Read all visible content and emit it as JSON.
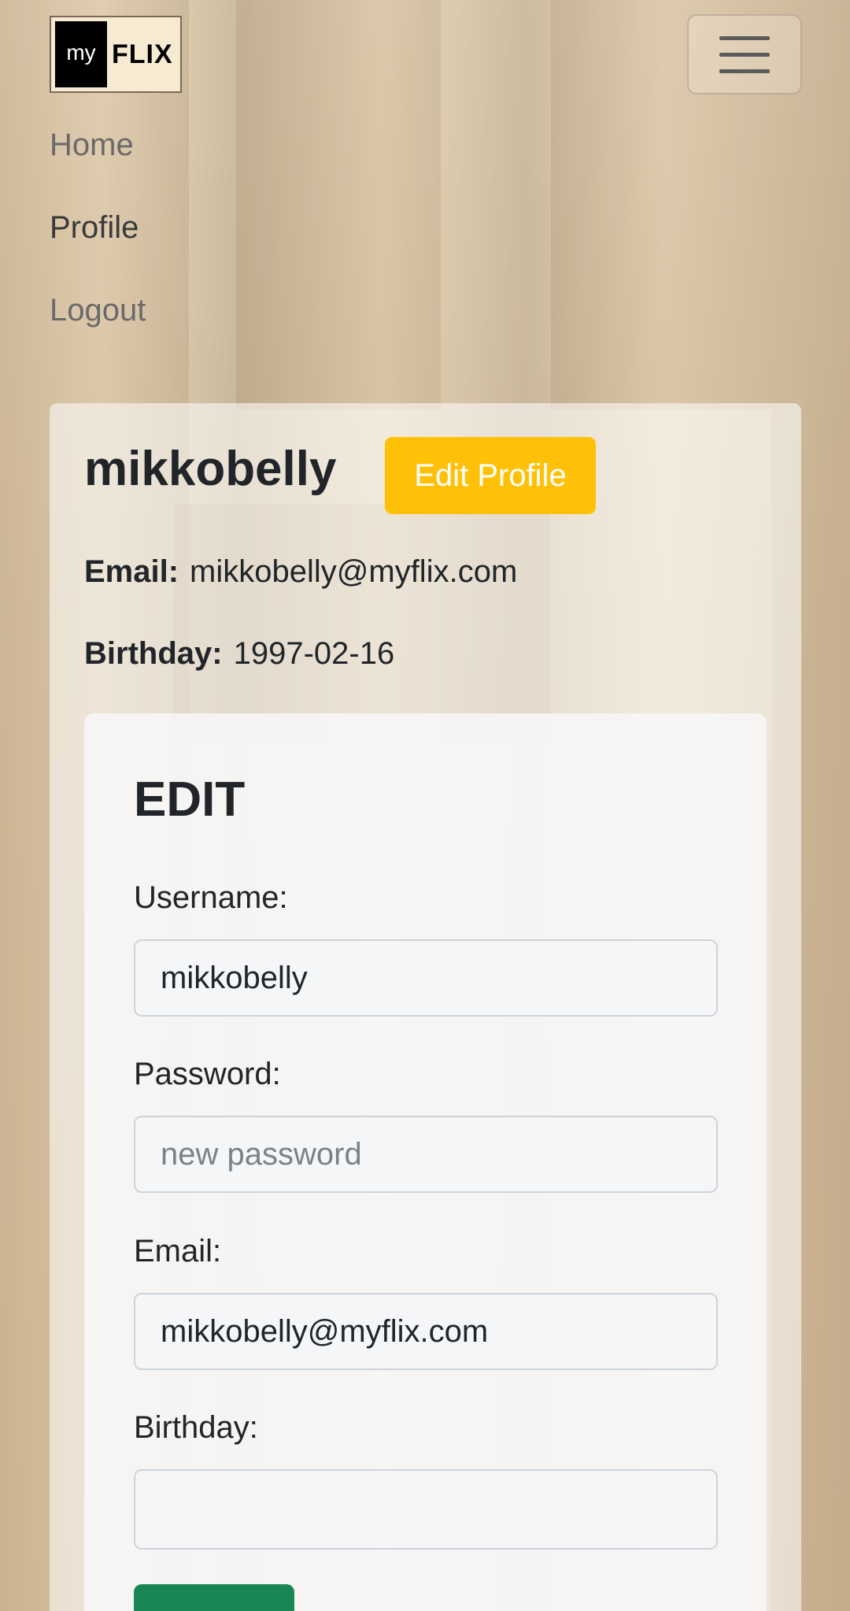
{
  "navbar": {
    "logo_my": "my",
    "logo_flix": "FLIX",
    "links": [
      "Home",
      "Profile",
      "Logout"
    ]
  },
  "profile": {
    "username": "mikkobelly",
    "edit_button": "Edit Profile",
    "email_label": "Email:",
    "email": "mikkobelly@myflix.com",
    "birthday_label": "Birthday:",
    "birthday": "1997-02-16"
  },
  "edit_form": {
    "heading": "EDIT",
    "username_label": "Username:",
    "username_value": "mikkobelly",
    "password_label": "Password:",
    "password_placeholder": "new password",
    "email_label": "Email:",
    "email_value": "mikkobelly@myflix.com",
    "birthday_label": "Birthday:",
    "birthday_value": ""
  },
  "colors": {
    "warning": "#ffc107",
    "success": "#198754"
  }
}
